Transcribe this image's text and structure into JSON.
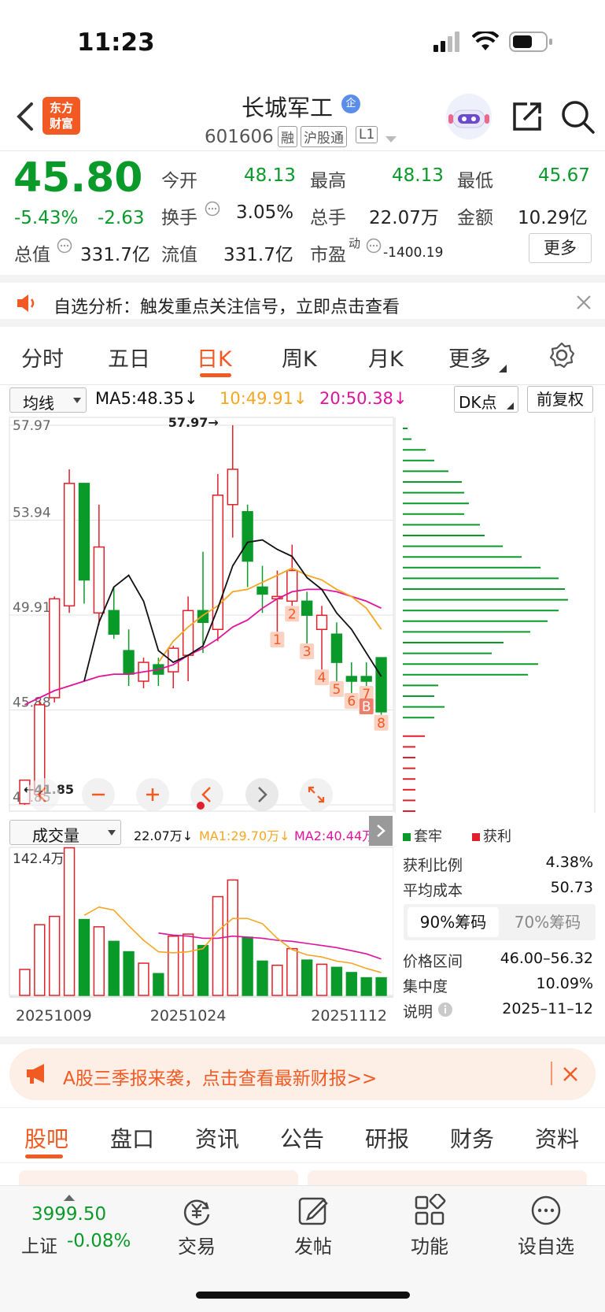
{
  "status_bar": {
    "time": "11:23"
  },
  "header": {
    "logo_line1": "东方",
    "logo_line2": "财富",
    "stock_name": "长城军工",
    "badge": "企",
    "code": "601606",
    "tags": [
      "融",
      "沪股通",
      "L1"
    ]
  },
  "quote": {
    "price": "45.80",
    "change_pct": "-5.43%",
    "change": "-2.63",
    "rows": [
      {
        "l1": "今开",
        "v1": "48.13",
        "l2": "最高",
        "v2": "48.13",
        "l3": "最低",
        "v3": "45.67"
      },
      {
        "l1": "换手",
        "v1": "3.05%",
        "l2": "总手",
        "v2": "22.07万",
        "l3": "金额",
        "v3": "10.29亿"
      },
      {
        "l1": "总值",
        "v1": "331.7亿",
        "l2": "流值",
        "v2": "331.7亿",
        "l3": "市盈",
        "v3": "-1400.19"
      }
    ],
    "pe_sup": "动",
    "more_btn": "更多"
  },
  "notice": {
    "text": "自选分析：触发重点关注信号，立即点击查看"
  },
  "chart_tabs": [
    "分时",
    "五日",
    "日K",
    "周K",
    "月K",
    "更多"
  ],
  "active_tab": "日K",
  "indicator_bar": {
    "selector": "均线",
    "ma5": "MA5:48.35↓",
    "ma10": "10:49.91↓",
    "ma20": "20:50.38↓",
    "dk": "DK点",
    "adjust": "前复权"
  },
  "colors": {
    "up": "#e0202a",
    "down": "#0a9a2a",
    "ma5": "#111111",
    "ma10": "#f5a623",
    "ma20": "#e0139b",
    "accent": "#ff5a00"
  },
  "chart_data": [
    {
      "type": "candlestick",
      "ylim": [
        41.85,
        57.97
      ],
      "y_ticks": [
        "57.97",
        "53.94",
        "49.91",
        "45.88",
        "41.85"
      ],
      "annotations": {
        "high": "57.97",
        "low": "41.85"
      },
      "signal_labels": [
        "1",
        "2",
        "3",
        "4",
        "5",
        "6",
        "7",
        "B",
        "8"
      ],
      "candles": [
        {
          "o": 41.9,
          "h": 42.2,
          "l": 41.85,
          "c": 42.9
        },
        {
          "o": 42.3,
          "h": 46.3,
          "l": 42.0,
          "c": 46.1
        },
        {
          "o": 46.4,
          "h": 50.7,
          "l": 46.2,
          "c": 50.6
        },
        {
          "o": 50.3,
          "h": 56.1,
          "l": 50.0,
          "c": 55.5
        },
        {
          "o": 55.5,
          "h": 55.5,
          "l": 50.4,
          "c": 51.4
        },
        {
          "o": 50.0,
          "h": 54.6,
          "l": 49.5,
          "c": 52.8
        },
        {
          "o": 50.1,
          "h": 51.1,
          "l": 48.9,
          "c": 49.1
        },
        {
          "o": 48.4,
          "h": 49.3,
          "l": 46.9,
          "c": 47.4
        },
        {
          "o": 47.1,
          "h": 48.1,
          "l": 46.8,
          "c": 47.9
        },
        {
          "o": 47.8,
          "h": 48.1,
          "l": 46.9,
          "c": 47.4
        },
        {
          "o": 47.5,
          "h": 48.6,
          "l": 46.8,
          "c": 48.5
        },
        {
          "o": 48.2,
          "h": 50.7,
          "l": 47.1,
          "c": 50.1
        },
        {
          "o": 50.1,
          "h": 52.6,
          "l": 48.3,
          "c": 49.6
        },
        {
          "o": 49.3,
          "h": 55.9,
          "l": 48.8,
          "c": 55.0
        },
        {
          "o": 54.6,
          "h": 57.97,
          "l": 53.2,
          "c": 56.1
        },
        {
          "o": 54.3,
          "h": 54.6,
          "l": 51.1,
          "c": 52.2
        },
        {
          "o": 51.1,
          "h": 52.0,
          "l": 50.0,
          "c": 50.8
        },
        {
          "o": 50.6,
          "h": 51.8,
          "l": 49.2,
          "c": 50.7
        },
        {
          "o": 50.5,
          "h": 52.9,
          "l": 50.3,
          "c": 51.8
        },
        {
          "o": 50.5,
          "h": 50.9,
          "l": 48.7,
          "c": 49.9
        },
        {
          "o": 49.3,
          "h": 50.3,
          "l": 47.6,
          "c": 49.9
        },
        {
          "o": 49.1,
          "h": 49.6,
          "l": 47.1,
          "c": 47.9
        },
        {
          "o": 47.3,
          "h": 47.9,
          "l": 46.6,
          "c": 47.1
        },
        {
          "o": 47.3,
          "h": 47.9,
          "l": 46.9,
          "c": 47.1
        },
        {
          "o": 48.1,
          "h": 48.1,
          "l": 45.67,
          "c": 45.8
        }
      ],
      "ma5": [
        null,
        null,
        null,
        null,
        47.1,
        49.6,
        51.1,
        51.6,
        50.5,
        48.4,
        47.9,
        48.2,
        48.6,
        50.2,
        52.0,
        53.0,
        53.1,
        52.7,
        52.4,
        51.5,
        51.0,
        50.0,
        49.3,
        48.3,
        47.3
      ],
      "ma10": [
        null,
        null,
        null,
        null,
        null,
        null,
        null,
        null,
        null,
        47.9,
        48.8,
        49.4,
        49.9,
        50.3,
        50.9,
        51.0,
        51.3,
        51.6,
        51.9,
        51.6,
        51.4,
        51.0,
        50.7,
        50.2,
        49.3
      ],
      "ma20": [
        46.1,
        46.4,
        46.7,
        46.9,
        47.1,
        47.3,
        47.4,
        47.4,
        47.5,
        47.6,
        47.8,
        48.2,
        48.5,
        48.9,
        49.4,
        49.7,
        50.2,
        50.6,
        50.9,
        51.0,
        51.0,
        50.9,
        50.7,
        50.5,
        50.2
      ]
    },
    {
      "type": "bar",
      "title": "成交量",
      "value_label": "22.07万↓",
      "ma1_label": "MA1:29.70万↓",
      "ma2_label": "MA2:40.44万",
      "ylim": [
        0,
        142.4
      ],
      "y_top_label": "142.4万",
      "x_labels": [
        "20251009",
        "20251024",
        "20251112"
      ],
      "volumes": [
        25,
        68,
        76,
        142,
        73,
        66,
        52,
        42,
        31,
        21,
        57,
        59,
        48,
        95,
        111,
        56,
        33,
        29,
        45,
        34,
        30,
        27,
        22,
        17,
        17
      ],
      "ma1": [
        null,
        null,
        null,
        null,
        77,
        85,
        82,
        67,
        53,
        42,
        41,
        42,
        45,
        62,
        74,
        74,
        69,
        55,
        44,
        39,
        37,
        33,
        31,
        26,
        22
      ],
      "ma2": [
        null,
        null,
        null,
        null,
        null,
        null,
        null,
        null,
        null,
        60,
        58,
        57,
        55,
        55,
        57,
        56,
        55,
        53,
        52,
        50,
        48,
        46,
        43,
        40,
        35
      ]
    }
  ],
  "chip": {
    "legend_trapped": "套牢",
    "legend_profit": "获利",
    "rows": [
      {
        "label": "获利比例",
        "value": "4.38%"
      },
      {
        "label": "平均成本",
        "value": "50.73"
      }
    ],
    "tab_active": "90%筹码",
    "tab_inactive": "70%筹码",
    "rows2": [
      {
        "label": "价格区间",
        "value": "46.00–56.32"
      },
      {
        "label": "集中度",
        "value": "10.09%"
      },
      {
        "label": "说明",
        "value": "2025–11–12"
      }
    ],
    "bars_green": [
      6,
      11,
      29,
      40,
      58,
      75,
      78,
      84,
      78,
      98,
      104,
      127,
      151,
      175,
      198,
      206,
      210,
      198,
      184,
      162,
      128,
      113,
      172,
      159,
      45,
      40,
      53,
      40
    ],
    "bars_red_count": 12
  },
  "banner": {
    "text": "A股三季报来袭，点击查看最新财报>>"
  },
  "bottom_tabs": [
    "股吧",
    "盘口",
    "资讯",
    "公告",
    "研报",
    "财务",
    "资料"
  ],
  "bottom_active": "股吧",
  "nav": {
    "index_value": "3999.50",
    "index_name": "上证",
    "index_change": "-0.08%",
    "items": [
      "交易",
      "发帖",
      "功能",
      "设自选"
    ]
  }
}
